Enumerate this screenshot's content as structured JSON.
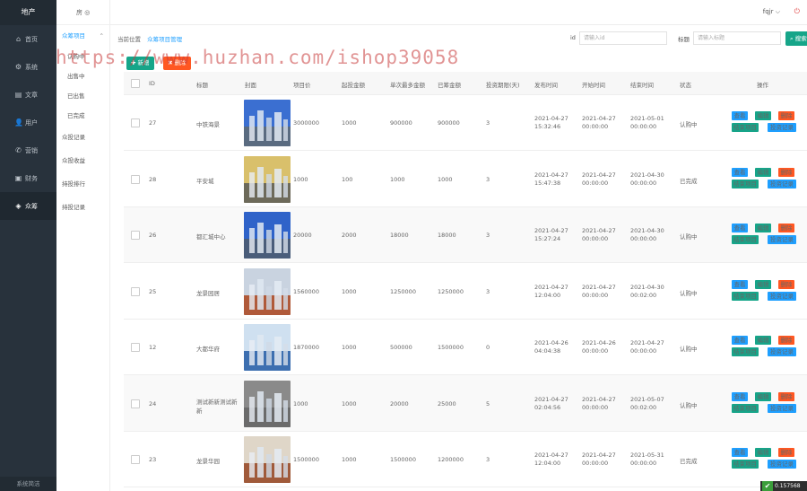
{
  "sidebar": {
    "logo": "地产",
    "items": [
      {
        "label": "首页",
        "icon": "home-icon",
        "glyph": "⌂"
      },
      {
        "label": "系统",
        "icon": "gear-icon",
        "glyph": "⚙"
      },
      {
        "label": "文章",
        "icon": "document-icon",
        "glyph": "▤"
      },
      {
        "label": "用户",
        "icon": "user-icon",
        "glyph": "👤"
      },
      {
        "label": "营销",
        "icon": "megaphone-icon",
        "glyph": "✆"
      },
      {
        "label": "财务",
        "icon": "wallet-icon",
        "glyph": "▣"
      },
      {
        "label": "众筹",
        "icon": "layers-icon",
        "glyph": "◈"
      }
    ],
    "footer": "系统简洁"
  },
  "submenu": {
    "top": "房 ◎",
    "group": "众筹项目",
    "items": [
      "认购中",
      "出售中",
      "已出售",
      "已完成"
    ],
    "links": [
      "众投记录",
      "众投收益",
      "持投排行",
      "持投记录"
    ]
  },
  "header": {
    "user": "fqjr ⌵",
    "power_glyph": "⏻"
  },
  "breadcrumb": {
    "prefix": "当前位置",
    "current": "众筹项目管理"
  },
  "search": {
    "id_label": "id",
    "id_placeholder": "请输入id",
    "title_label": "标题",
    "title_placeholder": "请输入标题",
    "button": "搜索"
  },
  "actions": {
    "add": "✚ 新增",
    "delete": "✖ 删除"
  },
  "watermark": "https://www.huzhan.com/ishop39058",
  "columns": [
    "ID",
    "标题",
    "封面",
    "项目价",
    "起投金额",
    "单次最多金额",
    "已筹金额",
    "投资期限(天)",
    "发布时间",
    "开始时间",
    "结束时间",
    "状态",
    "操作"
  ],
  "rows": [
    {
      "id": "27",
      "title": "中铁海景",
      "price": "3000000",
      "min": "1000",
      "max": "900000",
      "raised": "900000",
      "term": "3",
      "pub": [
        "2021-04-27",
        "15:32:46"
      ],
      "start": [
        "2021-04-27",
        "00:00:00"
      ],
      "end": [
        "2021-05-01",
        "00:00:00"
      ],
      "status": "认购中",
      "ops": [
        "查看",
        "编辑",
        "删除",
        "结束项目",
        "投资记录"
      ]
    },
    {
      "id": "28",
      "title": "平安城",
      "price": "1000",
      "min": "100",
      "max": "1000",
      "raised": "1000",
      "term": "3",
      "pub": [
        "2021-04-27",
        "15:47:38"
      ],
      "start": [
        "2021-04-27",
        "00:00:00"
      ],
      "end": [
        "2021-04-30",
        "00:00:00"
      ],
      "status": "已完成",
      "ops": [
        "查看",
        "编辑",
        "删除",
        "结束项目",
        "投资记录"
      ]
    },
    {
      "id": "26",
      "title": "都汇城中心",
      "price": "20000",
      "min": "2000",
      "max": "18000",
      "raised": "18000",
      "term": "3",
      "pub": [
        "2021-04-27",
        "15:27:24"
      ],
      "start": [
        "2021-04-27",
        "00:00:00"
      ],
      "end": [
        "2021-04-30",
        "00:00:00"
      ],
      "status": "认购中",
      "ops": [
        "查看",
        "编辑",
        "删除",
        "结束项目",
        "投资记录"
      ]
    },
    {
      "id": "25",
      "title": "龙景园居",
      "price": "1560000",
      "min": "1000",
      "max": "1250000",
      "raised": "1250000",
      "term": "3",
      "pub": [
        "2021-04-27",
        "12:04:00"
      ],
      "start": [
        "2021-04-27",
        "00:00:00"
      ],
      "end": [
        "2021-04-30",
        "00:02:00"
      ],
      "status": "认购中",
      "ops": [
        "查看",
        "编辑",
        "删除",
        "结束项目",
        "投资记录"
      ]
    },
    {
      "id": "12",
      "title": "大都华府",
      "price": "1870000",
      "min": "1000",
      "max": "500000",
      "raised": "1500000",
      "term": "0",
      "pub": [
        "2021-04-26",
        "04:04:38"
      ],
      "start": [
        "2021-04-26",
        "00:00:00"
      ],
      "end": [
        "2021-04-27",
        "00:00:00"
      ],
      "status": "认购中",
      "ops": [
        "查看",
        "编辑",
        "删除",
        "结束项目",
        "投资记录"
      ]
    },
    {
      "id": "24",
      "title": "测试新新测试新新",
      "price": "1000",
      "min": "1000",
      "max": "20000",
      "raised": "25000",
      "term": "5",
      "pub": [
        "2021-04-27",
        "02:04:56"
      ],
      "start": [
        "2021-04-27",
        "00:00:00"
      ],
      "end": [
        "2021-05-07",
        "00:02:00"
      ],
      "status": "认购中",
      "ops": [
        "查看",
        "编辑",
        "删除",
        "结束项目",
        "投资记录"
      ]
    },
    {
      "id": "23",
      "title": "龙景华园",
      "price": "1500000",
      "min": "1000",
      "max": "1500000",
      "raised": "1200000",
      "term": "3",
      "pub": [
        "2021-04-27",
        "12:04:00"
      ],
      "start": [
        "2021-04-27",
        "00:00:00"
      ],
      "end": [
        "2021-05-31",
        "00:00:00"
      ],
      "status": "已完成",
      "ops": [
        "查看",
        "编辑",
        "删除",
        "结束项目",
        "投资记录"
      ]
    }
  ],
  "badge": "0.157568",
  "colors": {
    "view": "#1e9fff",
    "edit": "#16a589",
    "delete": "#ff5722",
    "end": "#16a589",
    "log": "#1e9fff",
    "add": "#16a589",
    "del": "#ff5722"
  }
}
